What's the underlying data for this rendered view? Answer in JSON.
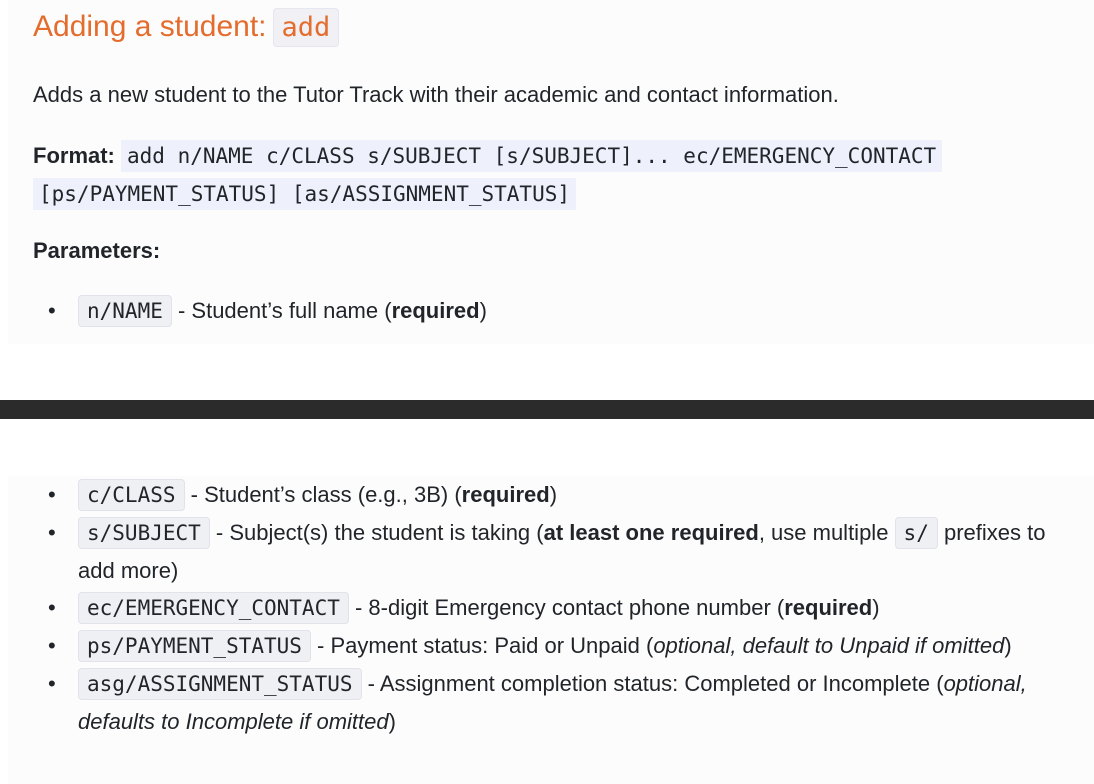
{
  "heading": {
    "text": "Adding a student:",
    "code": "add"
  },
  "description": "Adds a new student to the Tutor Track with their academic and contact information.",
  "format": {
    "label": "Format:",
    "line1": "add n/NAME c/CLASS s/SUBJECT [s/SUBJECT]... ec/EMERGENCY_CONTACT",
    "line2": "[ps/PAYMENT_STATUS] [as/ASSIGNMENT_STATUS]"
  },
  "parameters_label": "Parameters:",
  "params": {
    "name": {
      "code": "n/NAME",
      "text": " - Student’s full name (",
      "bold": "required",
      "end": ")"
    },
    "class": {
      "code": "c/CLASS",
      "text": " - Student’s class (e.g., 3B) (",
      "bold": "required",
      "end": ")"
    },
    "subject": {
      "code": "s/SUBJECT",
      "text": " - Subject(s) the student is taking (",
      "bold": "at least one required",
      "mid": ", use multiple ",
      "code2": "s/",
      "end": " prefixes to add more)"
    },
    "emergency": {
      "code": "ec/EMERGENCY_CONTACT",
      "text": " - 8-digit Emergency contact phone number (",
      "bold": "required",
      "end": ")"
    },
    "payment": {
      "code": "ps/PAYMENT_STATUS",
      "text": " - Payment status: Paid or Unpaid (",
      "italic": "optional, default to Unpaid if omitted",
      "end": ")"
    },
    "assignment": {
      "code": "asg/ASSIGNMENT_STATUS",
      "text": " - Assignment completion status: Completed or Incomplete (",
      "italic": "optional, defaults to Incomplete if omitted",
      "end": ")"
    }
  },
  "colors": {
    "heading": "#e46c2c",
    "divider": "#2b2b2b",
    "code_bg": "#eff0f4"
  }
}
